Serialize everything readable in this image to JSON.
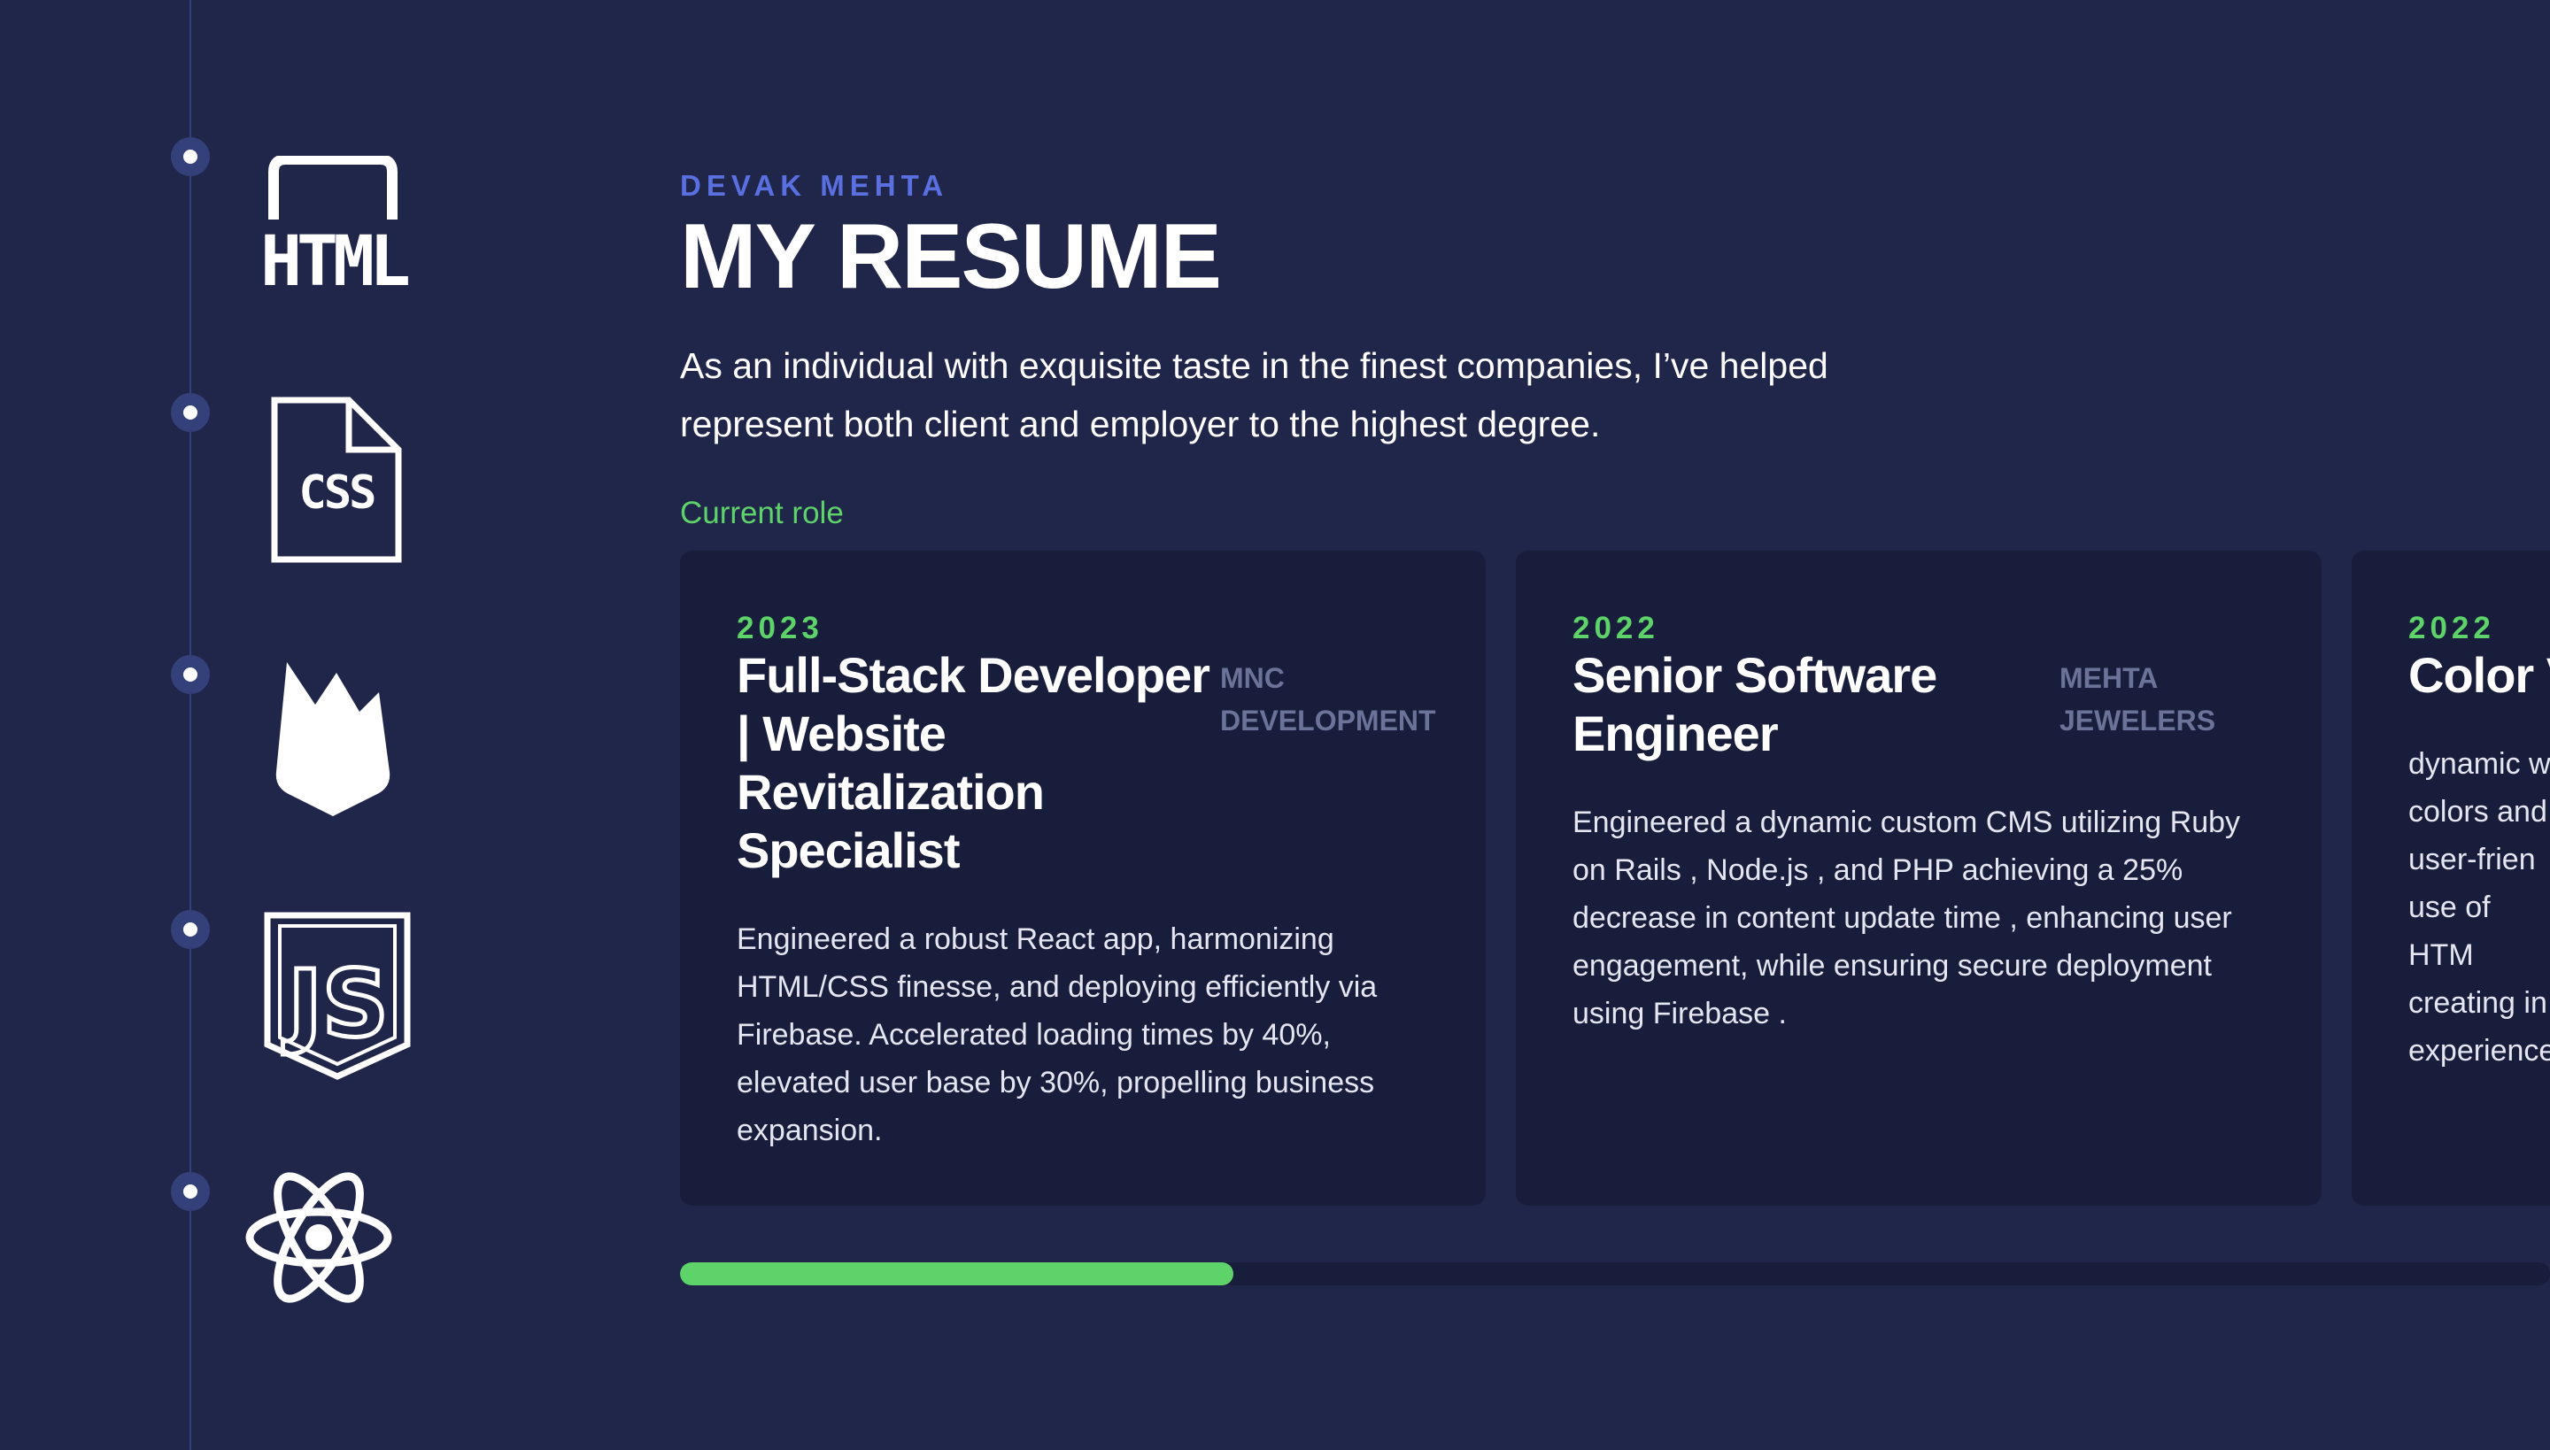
{
  "header": {
    "author": "DEVAK MEHTA",
    "title": "MY RESUME",
    "intro": "As an individual with exquisite taste in the finest companies, I’ve helped represent both client and employer to the highest degree."
  },
  "timeline": {
    "icons": [
      "html-icon",
      "css-icon",
      "firebase-icon",
      "javascript-icon",
      "react-icon"
    ],
    "html_text": "HTML",
    "css_text": "CSS",
    "js_text": "JS"
  },
  "current_role_label": "Current role",
  "cards": [
    {
      "year": "2023",
      "role": "Full-Stack Developer | Website Revitalization Specialist",
      "company": "MNC DEVELOPMENT",
      "description": "Engineered a robust React app, harmonizing HTML/CSS finesse, and deploying efficiently via Firebase. Accelerated loading times by 40%, elevated user base by 30%, propelling business expansion."
    },
    {
      "year": "2022",
      "role": "Senior Software Engineer",
      "company": "MEHTA JEWELERS",
      "description": "Engineered a dynamic custom CMS utilizing Ruby on Rails , Node.js , and PHP achieving a 25% decrease in content update time , enhancing user engagement, while ensuring secure deployment using Firebase ."
    },
    {
      "year": "2022",
      "role": "Color V",
      "company": "",
      "description": "dynamic w colors and user-frien use of HTM creating in experience"
    }
  ],
  "carousel_progress_percent": 29.6,
  "colors": {
    "background": "#20264a",
    "card": "#181d3c",
    "accent_green": "#5dd36a",
    "accent_blue": "#5a6fe0",
    "muted": "#6c7399"
  }
}
